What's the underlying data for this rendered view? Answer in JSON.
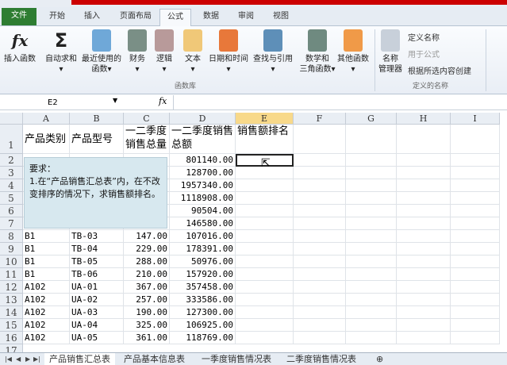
{
  "ribbon_tabs": [
    "文件",
    "开始",
    "插入",
    "页面布局",
    "公式",
    "数据",
    "审阅",
    "视图"
  ],
  "active_tab": "公式",
  "buttons": {
    "insert_function": "插入函数",
    "autosum": "自动求和",
    "recent": "最近使用的",
    "recent2": "函数",
    "financial": "财务",
    "logical": "逻辑",
    "text": "文本",
    "datetime": "日期和时间",
    "lookup": "查找与引用",
    "math": "数学和",
    "math2": "三角函数",
    "other": "其他函数",
    "name_mgr": "名称",
    "name_mgr2": "管理器",
    "define_name": "定义名称",
    "use_in_formula": "用于公式",
    "create_from_sel": "根据所选内容创建"
  },
  "groups": {
    "library": "函数库",
    "defined_names": "定义的名称"
  },
  "formula_bar": {
    "name_box": "E2",
    "fx": "fx",
    "formula": ""
  },
  "columns": [
    "A",
    "B",
    "C",
    "D",
    "E",
    "F",
    "G",
    "H",
    "I"
  ],
  "header_row": [
    "产品类别",
    "产品型号",
    "一二季度销售总量",
    "一二季度销售总额",
    "销售额排名"
  ],
  "rows": [
    [
      "",
      "",
      "",
      "801140.00"
    ],
    [
      "",
      "",
      "",
      "128700.00"
    ],
    [
      "",
      "",
      "",
      "1957340.00"
    ],
    [
      "",
      "",
      "",
      "1118908.00"
    ],
    [
      "",
      "",
      "",
      "90504.00"
    ],
    [
      "",
      "",
      "",
      "146580.00"
    ],
    [
      "B1",
      "TB-03",
      "147.00",
      "107016.00"
    ],
    [
      "B1",
      "TB-04",
      "229.00",
      "178391.00"
    ],
    [
      "B1",
      "TB-05",
      "288.00",
      "50976.00"
    ],
    [
      "B1",
      "TB-06",
      "210.00",
      "157920.00"
    ],
    [
      "A102",
      "UA-01",
      "367.00",
      "357458.00"
    ],
    [
      "A102",
      "UA-02",
      "257.00",
      "333586.00"
    ],
    [
      "A102",
      "UA-03",
      "190.00",
      "127300.00"
    ],
    [
      "A102",
      "UA-04",
      "325.00",
      "106925.00"
    ],
    [
      "A102",
      "UA-05",
      "361.00",
      "118769.00"
    ]
  ],
  "note": {
    "title": "要求：",
    "body": "1.在“产品销售汇总表”内，在不改变排序的情况下，求销售额排名。"
  },
  "sheets": [
    "产品销售汇总表",
    "产品基本信息表",
    "一季度销售情况表",
    "二季度销售情况表"
  ]
}
